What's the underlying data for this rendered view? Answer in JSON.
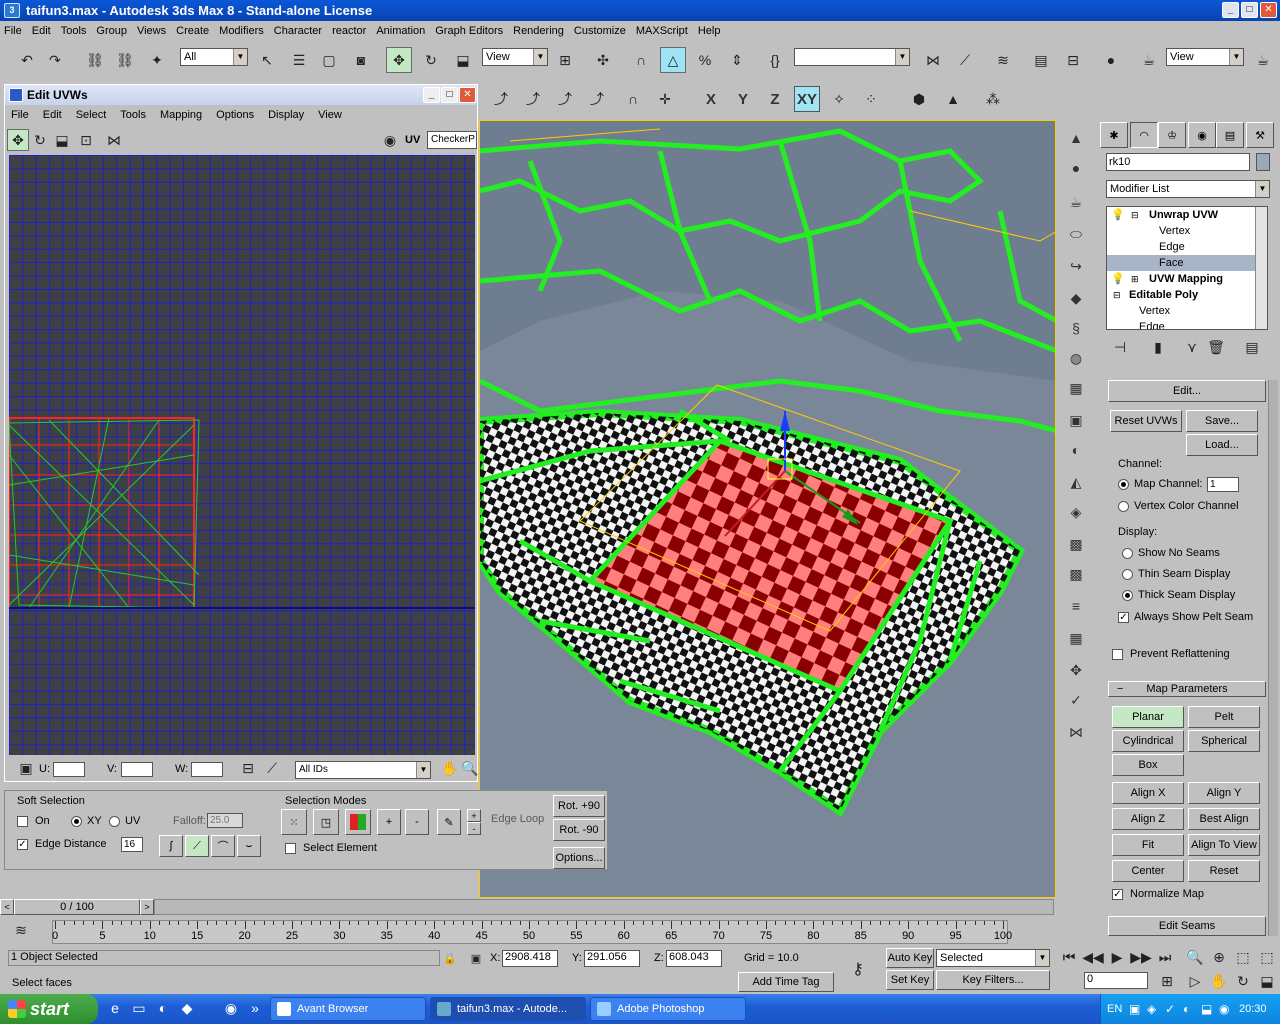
{
  "window": {
    "title": "taifun3.max - Autodesk 3ds Max 8 - Stand-alone License",
    "min": "_",
    "max": "□",
    "close": "✕"
  },
  "menu": [
    "File",
    "Edit",
    "Tools",
    "Group",
    "Views",
    "Create",
    "Modifiers",
    "Character",
    "reactor",
    "Animation",
    "Graph Editors",
    "Rendering",
    "Customize",
    "MAXScript",
    "Help"
  ],
  "toolbar": {
    "selection_filter": "All",
    "ref_coord": "View",
    "named_sel": "",
    "ref_coord2": "View",
    "axis": [
      "X",
      "Y",
      "Z",
      "XY"
    ]
  },
  "uvw": {
    "title": "Edit UVWs",
    "menu": [
      "File",
      "Edit",
      "Select",
      "Tools",
      "Mapping",
      "Options",
      "Display",
      "View"
    ],
    "uv_label": "UV",
    "checker": "CheckerP",
    "u_label": "U:",
    "v_label": "V:",
    "w_label": "W:",
    "ids": "All IDs"
  },
  "soft": {
    "title": "Soft Selection",
    "on": "On",
    "xy": "XY",
    "uv": "UV",
    "falloff_label": "Falloff:",
    "falloff": "25.0",
    "edge_distance": "Edge Distance",
    "edge_value": "16",
    "modes_title": "Selection Modes",
    "edge_loop": "Edge Loop",
    "select_element": "Select Element",
    "rot_p90": "Rot. +90",
    "rot_m90": "Rot. -90",
    "options": "Options..."
  },
  "panel": {
    "object_name": "rk10",
    "modifier_list": "Modifier List",
    "stack": [
      {
        "label": "Unwrap UVW",
        "level": 0,
        "bold": true
      },
      {
        "label": "Vertex",
        "level": 1
      },
      {
        "label": "Edge",
        "level": 1
      },
      {
        "label": "Face",
        "level": 1,
        "selected": true
      },
      {
        "label": "UVW Mapping",
        "level": 0,
        "bold": true
      },
      {
        "label": "Editable Poly",
        "level": 0,
        "bold": true
      },
      {
        "label": "Vertex",
        "level": 1
      },
      {
        "label": "Edge",
        "level": 1
      }
    ],
    "edit": "Edit...",
    "reset": "Reset UVWs",
    "save": "Save...",
    "load": "Load...",
    "channel": "Channel:",
    "map_channel": "Map Channel:",
    "map_channel_value": "1",
    "vertex_color": "Vertex Color Channel",
    "display": "Display:",
    "no_seams": "Show No Seams",
    "thin_seam": "Thin Seam Display",
    "thick_seam": "Thick Seam Display",
    "pelt_seam": "Always Show Pelt Seam",
    "prevent": "Prevent Reflattening",
    "map_params": "Map Parameters",
    "planar": "Planar",
    "pelt": "Pelt",
    "cylindrical": "Cylindrical",
    "spherical": "Spherical",
    "box": "Box",
    "align_x": "Align X",
    "align_y": "Align Y",
    "align_z": "Align Z",
    "best_align": "Best Align",
    "fit": "Fit",
    "align_view": "Align To View",
    "center": "Center",
    "reset_btn": "Reset",
    "normalize": "Normalize Map",
    "edit_seams": "Edit Seams"
  },
  "time": {
    "slider": "0 / 100",
    "ticks": [
      "0",
      "5",
      "10",
      "15",
      "20",
      "25",
      "30",
      "35",
      "40",
      "45",
      "50",
      "55",
      "60",
      "65",
      "70",
      "75",
      "80",
      "85",
      "90",
      "95",
      "100"
    ]
  },
  "status": {
    "selected": "1 Object Selected",
    "prompt": "Select faces",
    "x_label": "X:",
    "x": "2908.418",
    "y_label": "Y:",
    "y": "291.056",
    "z_label": "Z:",
    "z": "608.043",
    "grid": "Grid = 10.0",
    "add_tag": "Add Time Tag",
    "auto_key": "Auto Key",
    "selected_combo": "Selected",
    "set_key": "Set Key",
    "key_filters": "Key Filters...",
    "frame": "0"
  },
  "taskbar": {
    "start": "start",
    "items": [
      "Avant Browser",
      "taifun3.max - Autode...",
      "Adobe Photoshop"
    ],
    "lang": "EN",
    "clock": "20:30"
  }
}
